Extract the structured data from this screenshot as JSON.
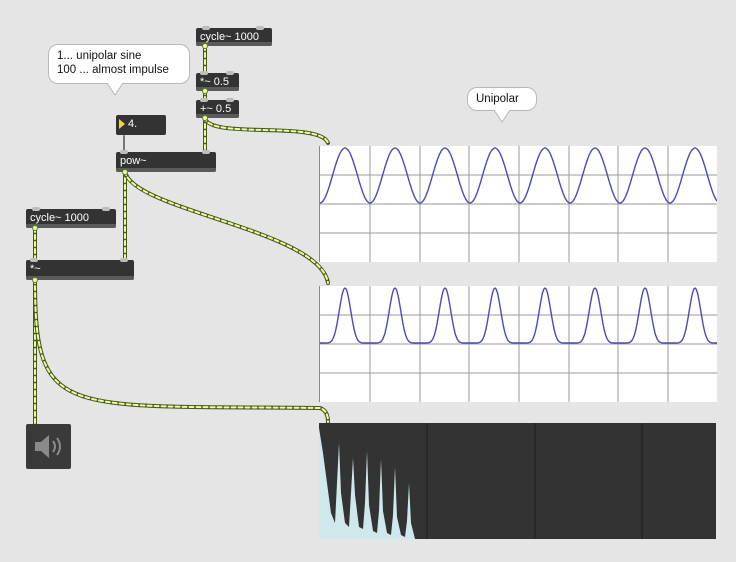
{
  "patcher": {
    "objects": {
      "cycle_top": "cycle~ 1000",
      "mul_half": "*~ 0.5",
      "add_half": "+~ 0.5",
      "pow": "pow~",
      "cycle_left": "cycle~ 1000",
      "mul": "*~"
    },
    "number_box": {
      "value": "4."
    },
    "comments": {
      "exponent_help": [
        "1... unipolar sine",
        "100 ... almost impulse"
      ],
      "unipolar": "Unipolar"
    },
    "dac_icon": "speaker-icon",
    "colors": {
      "background": "#e5e5e5",
      "object": "#333333",
      "patch_cord": "#6b7a2a",
      "patch_cord_dash": "#e5ff9a",
      "waveform": "#4a4ab8",
      "spectrum": "#cfe8ec",
      "number_triangle": "#f2d33a"
    }
  }
}
